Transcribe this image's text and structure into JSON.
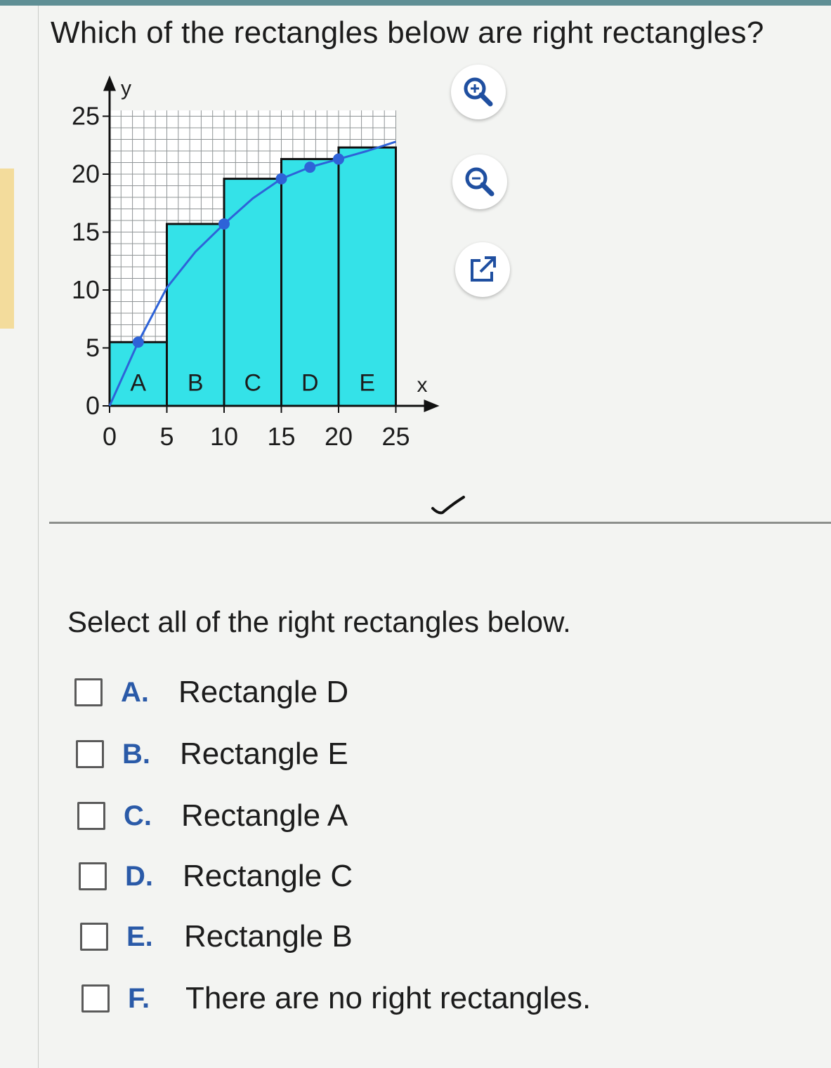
{
  "question": {
    "text": "Which of the rectangles below are right rectangles?"
  },
  "toolbar": {
    "zoom_in": "zoom-in-icon",
    "zoom_out": "zoom-out-icon",
    "popout": "external-link-icon"
  },
  "chart_data": {
    "type": "bar",
    "xlabel": "x",
    "ylabel": "y",
    "xlim": [
      0,
      25
    ],
    "ylim": [
      0,
      25
    ],
    "xticks": [
      "0",
      "5",
      "10",
      "15",
      "20",
      "25"
    ],
    "yticks": [
      "0",
      "5",
      "10",
      "15",
      "20",
      "25"
    ],
    "grid": true,
    "grid_step": 1,
    "fill_color": "#34e2e8",
    "curve_color": "#2e63d8",
    "rectangles": [
      {
        "label": "A",
        "x0": 0,
        "x1": 5,
        "height": 5.5
      },
      {
        "label": "B",
        "x0": 5,
        "x1": 10,
        "height": 15.7
      },
      {
        "label": "C",
        "x0": 10,
        "x1": 15,
        "height": 19.6
      },
      {
        "label": "D",
        "x0": 15,
        "x1": 20,
        "height": 21.3
      },
      {
        "label": "E",
        "x0": 20,
        "x1": 25,
        "height": 22.3
      }
    ],
    "curve": [
      {
        "x": 0,
        "y": 0
      },
      {
        "x": 2.5,
        "y": 5.5
      },
      {
        "x": 5,
        "y": 10.2
      },
      {
        "x": 7.5,
        "y": 13.3
      },
      {
        "x": 10,
        "y": 15.7
      },
      {
        "x": 12.5,
        "y": 17.9
      },
      {
        "x": 15,
        "y": 19.6
      },
      {
        "x": 17.5,
        "y": 20.6
      },
      {
        "x": 20,
        "y": 21.3
      },
      {
        "x": 22.5,
        "y": 22.0
      },
      {
        "x": 25,
        "y": 22.8
      }
    ],
    "points": [
      {
        "x": 2.5,
        "y": 5.5
      },
      {
        "x": 10,
        "y": 15.7
      },
      {
        "x": 15,
        "y": 19.6
      },
      {
        "x": 17.5,
        "y": 20.6
      },
      {
        "x": 20,
        "y": 21.3
      }
    ]
  },
  "answer": {
    "prompt": "Select all of the right rectangles below.",
    "options": [
      {
        "letter": "A.",
        "text": "Rectangle D",
        "checked": false
      },
      {
        "letter": "B.",
        "text": "Rectangle E",
        "checked": false
      },
      {
        "letter": "C.",
        "text": "Rectangle A",
        "checked": false
      },
      {
        "letter": "D.",
        "text": "Rectangle C",
        "checked": false
      },
      {
        "letter": "E.",
        "text": "Rectangle B",
        "checked": false
      },
      {
        "letter": "F.",
        "text": "There are no right rectangles.",
        "checked": false
      }
    ]
  }
}
